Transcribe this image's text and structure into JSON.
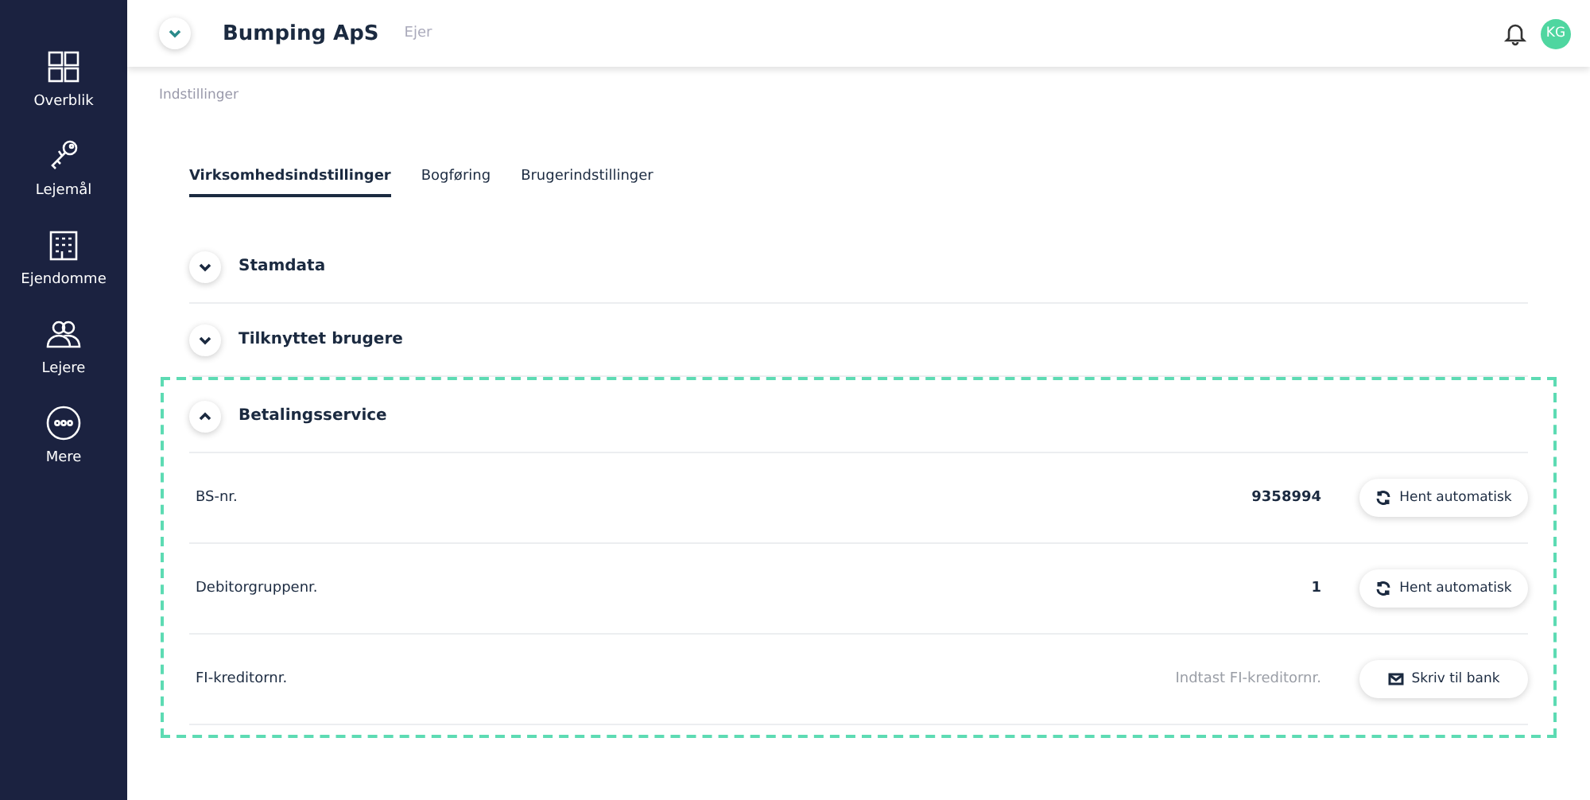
{
  "sidebar": {
    "items": [
      {
        "label": "Overblik"
      },
      {
        "label": "Lejemål"
      },
      {
        "label": "Ejendomme"
      },
      {
        "label": "Lejere"
      },
      {
        "label": "Mere"
      }
    ]
  },
  "header": {
    "company": "Bumping ApS",
    "role": "Ejer",
    "avatar": "KG"
  },
  "breadcrumb": "Indstillinger",
  "tabs": [
    {
      "label": "Virksomhedsindstillinger",
      "selected": true
    },
    {
      "label": "Bogføring",
      "selected": false
    },
    {
      "label": "Brugerindstillinger",
      "selected": false
    }
  ],
  "sections": [
    {
      "title": "Stamdata",
      "expanded": false,
      "highlighted": false
    },
    {
      "title": "Tilknyttet brugere",
      "expanded": false,
      "highlighted": false
    },
    {
      "title": "Betalingsservice",
      "expanded": true,
      "highlighted": true,
      "rows": [
        {
          "label": "BS-nr.",
          "kind": "value",
          "value": "9358994",
          "button": {
            "label": "Hent automatisk",
            "kind": "refresh"
          }
        },
        {
          "label": "Debitorgruppenr.",
          "kind": "value",
          "value": "1",
          "button": {
            "label": "Hent automatisk",
            "kind": "refresh"
          }
        },
        {
          "label": "FI-kreditornr.",
          "kind": "input",
          "placeholder": "Indtast FI-kreditornr.",
          "button": {
            "label": "Skriv til bank",
            "kind": "mail"
          }
        }
      ]
    }
  ]
}
